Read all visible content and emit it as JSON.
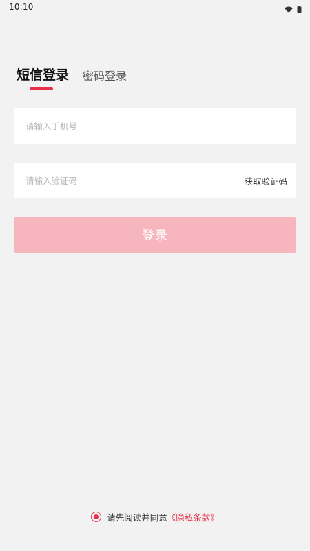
{
  "status_bar": {
    "time": "10:10",
    "icons": [
      "wifi-icon",
      "battery-icon"
    ]
  },
  "tabs": [
    {
      "label": "短信登录",
      "active": true
    },
    {
      "label": "密码登录",
      "active": false
    }
  ],
  "phone_field": {
    "placeholder": "请输入手机号",
    "value": ""
  },
  "code_field": {
    "placeholder": "请输入验证码",
    "value": "",
    "get_code_label": "获取验证码"
  },
  "login_button": {
    "label": "登录"
  },
  "agreement": {
    "checked": true,
    "text": "请先阅读并同意",
    "link_text": "《隐私条款》"
  },
  "colors": {
    "background": "#f2f2f2",
    "accent": "#e8304b",
    "button_disabled": "#f7b5bd",
    "field_background": "#ffffff"
  }
}
